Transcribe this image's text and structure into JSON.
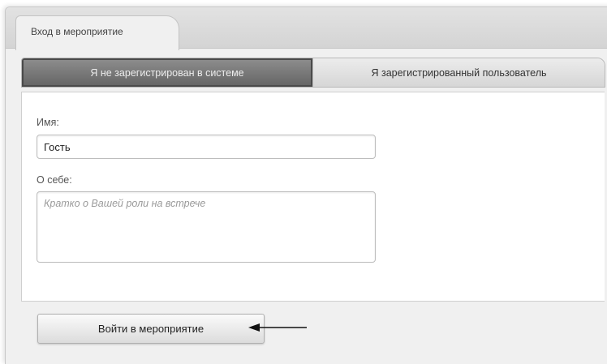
{
  "window_tab": {
    "label": "Вход в мероприятие"
  },
  "mode_tabs": [
    {
      "label": "Я не зарегистрирован в системе",
      "active": true
    },
    {
      "label": "Я зарегистрированный пользователь",
      "active": false
    }
  ],
  "form": {
    "name_label": "Имя:",
    "name_value": "Гость",
    "about_label": "О себе:",
    "about_placeholder": "Кратко о Вашей роли на встрече"
  },
  "submit": {
    "label": "Войти в мероприятие"
  },
  "annotation": {
    "icon": "arrow-left-icon"
  }
}
